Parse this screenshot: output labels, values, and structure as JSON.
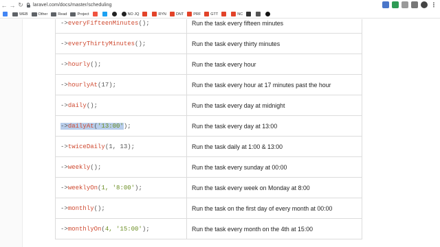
{
  "browser": {
    "url": "laravel.com/docs/master/scheduling",
    "bookmarks": [
      {
        "label": "",
        "icon": "apps-grid-icon",
        "color": "#4285f4"
      },
      {
        "label": "WEB",
        "icon": "folder-icon",
        "color": "#5f6368"
      },
      {
        "label": "Other",
        "icon": "folder-icon",
        "color": "#5f6368"
      },
      {
        "label": "Read",
        "icon": "folder-icon",
        "color": "#5f6368"
      },
      {
        "label": "Project",
        "icon": "folder-icon",
        "color": "#5f6368"
      },
      {
        "label": "",
        "icon": "laravel-icon",
        "color": "#f05340"
      },
      {
        "label": "",
        "icon": "twitter-icon",
        "color": "#1da1f2"
      },
      {
        "label": "",
        "icon": "github-icon",
        "color": "#222222"
      },
      {
        "label": "NO JQ",
        "icon": "github-icon",
        "color": "#222222"
      },
      {
        "label": "",
        "icon": "gitlab-icon",
        "color": "#e24329"
      },
      {
        "label": "RYN",
        "icon": "gitlab-icon",
        "color": "#e24329"
      },
      {
        "label": "DNT",
        "icon": "gitlab-icon",
        "color": "#e24329"
      },
      {
        "label": "PRF",
        "icon": "gitlab-icon",
        "color": "#e24329"
      },
      {
        "label": "GTT",
        "icon": "gitlab-icon",
        "color": "#e24329"
      },
      {
        "label": "",
        "icon": "gitlab-icon",
        "color": "#e24329"
      },
      {
        "label": "NC",
        "icon": "gitlab-icon",
        "color": "#e24329"
      },
      {
        "label": "",
        "icon": "square-icon",
        "color": "#333333"
      },
      {
        "label": "",
        "icon": "grid-icon",
        "color": "#555555"
      },
      {
        "label": "",
        "icon": "circle-icon",
        "color": "#111111"
      }
    ],
    "extensions": [
      {
        "icon": "extension-blue-icon",
        "color": "#4a76c9"
      },
      {
        "icon": "extension-green-icon",
        "color": "#2e9b54"
      },
      {
        "icon": "extension-gray-icon",
        "color": "#9a9a9a"
      },
      {
        "icon": "extension-menu-icon",
        "color": "#777777"
      },
      {
        "icon": "profile-avatar-icon",
        "color": "#444444"
      },
      {
        "icon": "kebab-menu-icon",
        "color": "#666666"
      }
    ]
  },
  "table": {
    "rows": [
      {
        "arrow": "->",
        "method": "everyFifteenMinutes",
        "args": "",
        "description": "Run the task every fifteen minutes"
      },
      {
        "arrow": "->",
        "method": "everyThirtyMinutes",
        "args": "",
        "description": "Run the task every thirty minutes"
      },
      {
        "arrow": "->",
        "method": "hourly",
        "args": "",
        "description": "Run the task every hour"
      },
      {
        "arrow": "->",
        "method": "hourlyAt",
        "args": "17",
        "description": "Run the task every hour at 17 minutes past the hour"
      },
      {
        "arrow": "->",
        "method": "daily",
        "args": "",
        "description": "Run the task every day at midnight"
      },
      {
        "arrow": "->",
        "method": "dailyAt",
        "args": "'13:00'",
        "description": "Run the task every day at 13:00",
        "selected": true
      },
      {
        "arrow": "->",
        "method": "twiceDaily",
        "args": "1, 13",
        "description": "Run the task daily at 1:00 & 13:00"
      },
      {
        "arrow": "->",
        "method": "weekly",
        "args": "",
        "description": "Run the task every sunday at 00:00"
      },
      {
        "arrow": "->",
        "method": "weeklyOn",
        "args": "1, '8:00'",
        "description": "Run the task every week on Monday at 8:00"
      },
      {
        "arrow": "->",
        "method": "monthly",
        "args": "",
        "description": "Run the task on the first day of every month at 00:00"
      },
      {
        "arrow": "->",
        "method": "monthlyOn",
        "args": "4, '15:00'",
        "description": "Run the task every month on the 4th at 15:00"
      }
    ]
  }
}
